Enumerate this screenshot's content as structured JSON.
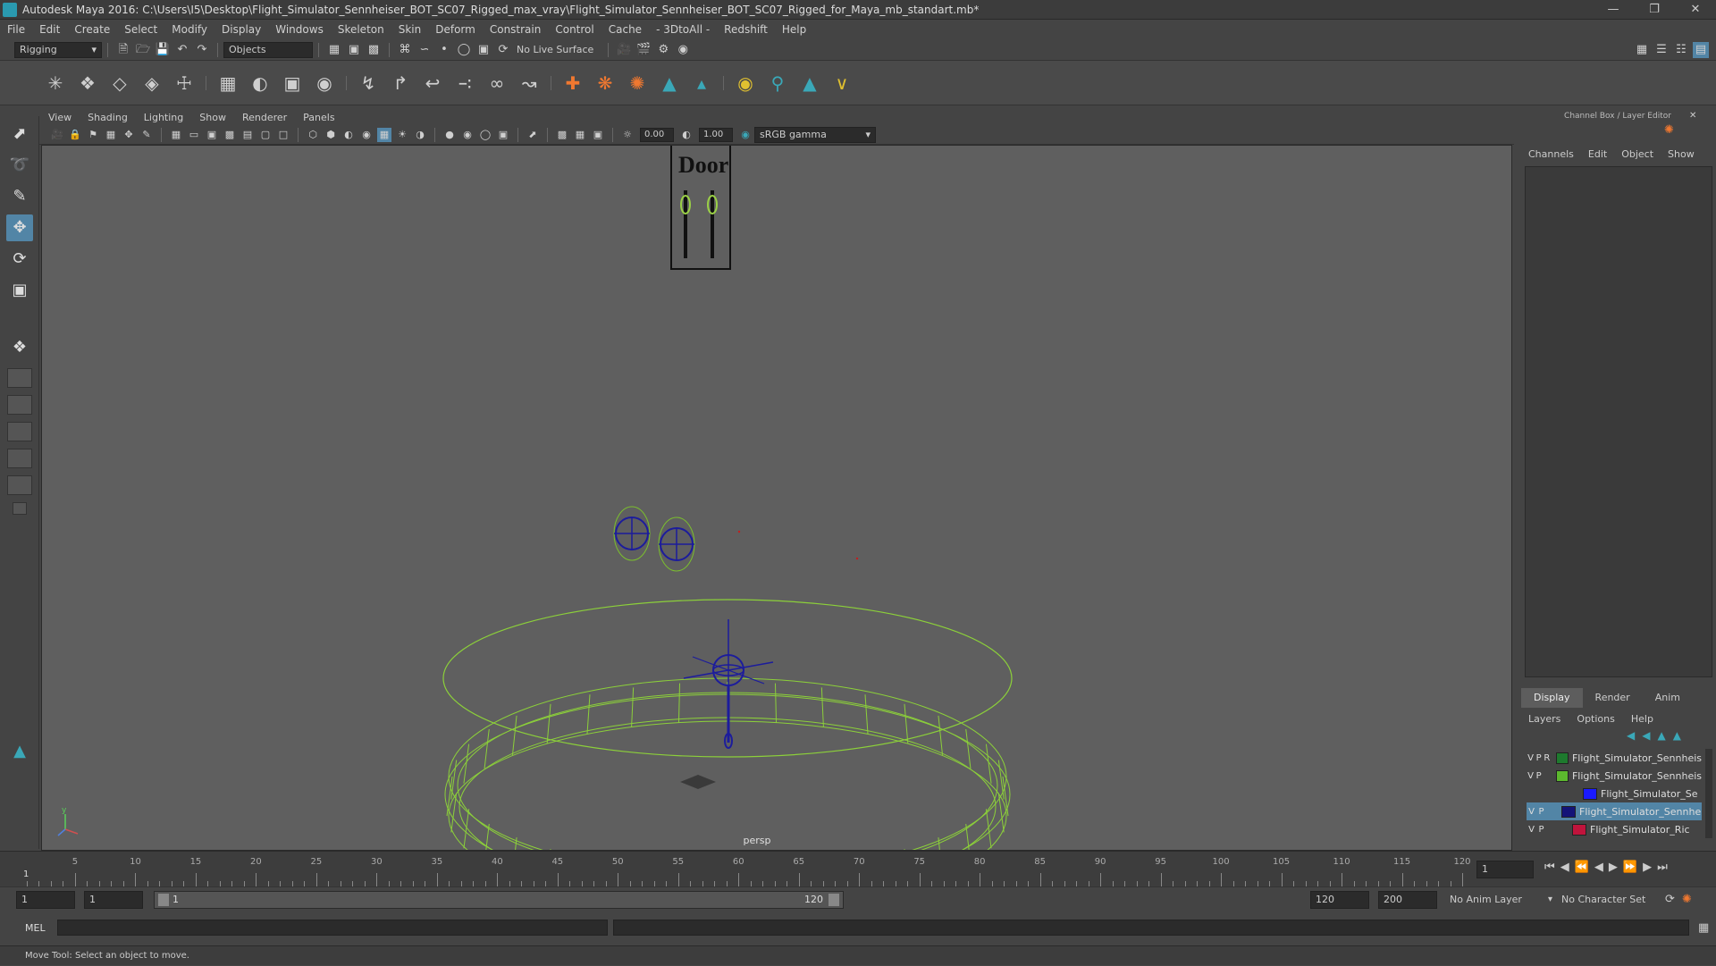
{
  "window": {
    "title": "Autodesk Maya 2016: C:\\Users\\I5\\Desktop\\Flight_Simulator_Sennheiser_BOT_SC07_Rigged_max_vray\\Flight_Simulator_Sennheiser_BOT_SC07_Rigged_for_Maya_mb_standart.mb*"
  },
  "menubar": [
    "File",
    "Edit",
    "Create",
    "Select",
    "Modify",
    "Display",
    "Windows",
    "Skeleton",
    "Skin",
    "Deform",
    "Constrain",
    "Control",
    "Cache",
    "- 3DtoAll -",
    "Redshift",
    "Help"
  ],
  "statusline": {
    "mode": "Rigging",
    "objects_label": "Objects",
    "live_surface": "No Live Surface"
  },
  "viewport": {
    "menu": [
      "View",
      "Shading",
      "Lighting",
      "Show",
      "Renderer",
      "Panels"
    ],
    "exposure": "0.00",
    "gamma": "1.00",
    "colorspace": "sRGB gamma",
    "camera_label": "persp",
    "door_label": "Door"
  },
  "channelbox": {
    "header": "Channel Box / Layer Editor",
    "menu": [
      "Channels",
      "Edit",
      "Object",
      "Show"
    ]
  },
  "layer_editor": {
    "tabs": [
      "Display",
      "Render",
      "Anim"
    ],
    "menu": [
      "Layers",
      "Options",
      "Help"
    ],
    "layers": [
      {
        "v": "V",
        "p": "P",
        "r": "R",
        "color": "#1e7a2e",
        "name": "Flight_Simulator_Sennheis",
        "selected": false
      },
      {
        "v": "V",
        "p": "P",
        "r": "",
        "color": "#5cb82e",
        "name": "Flight_Simulator_Sennheis",
        "selected": false
      },
      {
        "v": "",
        "p": "",
        "r": "",
        "color": "#1a1aff",
        "name": "Flight_Simulator_Se",
        "selected": false
      },
      {
        "v": "V",
        "p": "P",
        "r": "",
        "color": "#141478",
        "name": "Flight_Simulator_Sennhe",
        "selected": true
      },
      {
        "v": "V",
        "p": "P",
        "r": "",
        "color": "#c0143c",
        "name": "Flight_Simulator_Ric",
        "selected": false
      }
    ]
  },
  "timeline": {
    "labels": [
      "5",
      "10",
      "15",
      "20",
      "25",
      "30",
      "35",
      "40",
      "45",
      "50",
      "55",
      "60",
      "65",
      "70",
      "75",
      "80",
      "85",
      "90",
      "95",
      "100",
      "105",
      "110",
      "115",
      "120"
    ],
    "start_label": "1",
    "current_frame": "1"
  },
  "range": {
    "start": "1",
    "playback_start": "1",
    "slider_start": "1",
    "slider_end": "120",
    "playback_end": "120",
    "end": "200",
    "anim_layer": "No Anim Layer",
    "character_set": "No Character Set"
  },
  "cmdline": {
    "label": "MEL"
  },
  "helpline": {
    "text": "Move Tool: Select an object to move."
  }
}
